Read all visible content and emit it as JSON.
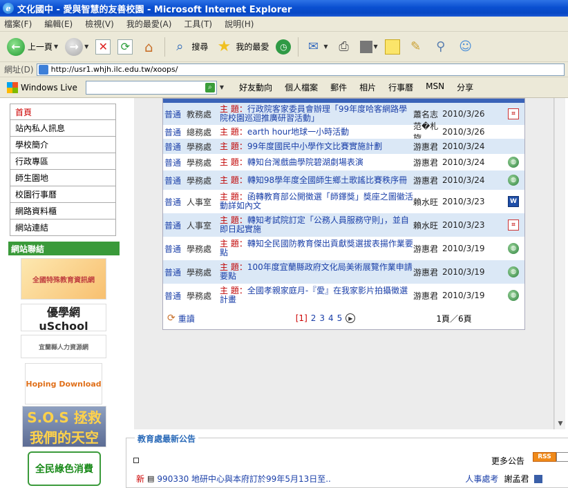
{
  "window": {
    "title": "文化國中 - 愛與智慧的友善校園 - Microsoft Internet Explorer"
  },
  "menu": [
    "檔案(F)",
    "編輯(E)",
    "檢視(V)",
    "我的最愛(A)",
    "工具(T)",
    "說明(H)"
  ],
  "toolbar": {
    "back_label": "上一頁",
    "search_label": "搜尋",
    "favorites_label": "我的最愛"
  },
  "address": {
    "label": "網址(D)",
    "url": "http://usr1.whjh.ilc.edu.tw/xoops/"
  },
  "livebar": {
    "brand": "Windows Live",
    "links": [
      "好友動向",
      "個人檔案",
      "郵件",
      "相片",
      "行事曆",
      "MSN",
      "分享"
    ]
  },
  "sidebar": {
    "items": [
      "首頁",
      "站內私人訊息",
      "學校簡介",
      "行政專區",
      "師生園地",
      "校園行事曆",
      "網路資料櫃",
      "網站連結"
    ],
    "links_header": "網站聯結",
    "banners": [
      "全國特殊教育資訊網",
      "優學網 uSchool",
      "宜蘭縣人力資源網",
      "Hoping Download",
      "S.O.S 拯救我們的天空",
      "全民綠色消費"
    ]
  },
  "news": {
    "subject_prefix": "主 題：",
    "rows": [
      {
        "type": "普通",
        "dept": "教務處",
        "title": "行政院客家委員會辦理「99年度哈客網路學院校園巡迴推廣研習活動」",
        "author": "蕭名志",
        "date": "2010/3/26",
        "icon": "pdf-icon",
        "alt": true
      },
      {
        "type": "普通",
        "dept": "總務處",
        "title": "earth hour地球一小時活動",
        "author": "范�札旋",
        "date": "2010/3/26",
        "icon": "",
        "alt": false
      },
      {
        "type": "普通",
        "dept": "學務處",
        "title": "99年度國民中小學作文比賽實施計劃",
        "author": "游惠君",
        "date": "2010/3/24",
        "icon": "",
        "alt": true
      },
      {
        "type": "普通",
        "dept": "學務處",
        "title": "轉知台灣戲曲學院碧湖劇場表演",
        "author": "游惠君",
        "date": "2010/3/24",
        "icon": "web-icon",
        "alt": false
      },
      {
        "type": "普通",
        "dept": "學務處",
        "title": "轉知98學年度全國師生鄉土歌謠比賽秩序冊",
        "author": "游惠君",
        "date": "2010/3/24",
        "icon": "web-icon",
        "alt": true
      },
      {
        "type": "普通",
        "dept": "人事室",
        "title": "函轉教育部公開徵選「師鐸獎」獎座之圖徽活動詳如內文",
        "author": "賴水旺",
        "date": "2010/3/23",
        "icon": "doc-icon",
        "alt": false
      },
      {
        "type": "普通",
        "dept": "人事室",
        "title": "轉知考試院訂定「公務人員服務守則」，並自即日起實施",
        "author": "賴水旺",
        "date": "2010/3/23",
        "icon": "pdf-icon",
        "alt": true
      },
      {
        "type": "普通",
        "dept": "學務處",
        "title": "轉知全民國防教育傑出貢獻獎選拔表揚作業要點",
        "author": "游惠君",
        "date": "2010/3/19",
        "icon": "web-icon",
        "alt": false
      },
      {
        "type": "普通",
        "dept": "學務處",
        "title": "100年度宜蘭縣政府文化局美術展覽作業申請要點",
        "author": "游惠君",
        "date": "2010/3/19",
        "icon": "web-icon",
        "alt": true
      },
      {
        "type": "普通",
        "dept": "學務處",
        "title": "全國孝親家庭月-『愛』在我家影片拍攝徵選計畫",
        "author": "游惠君",
        "date": "2010/3/19",
        "icon": "web-icon",
        "alt": false
      }
    ],
    "pager": {
      "reload": "重讀",
      "current": "[1]",
      "pages": [
        "2",
        "3",
        "4",
        "5"
      ],
      "count": "1頁／6頁"
    }
  },
  "bottom": {
    "title": "教育處最新公告",
    "more": "更多公告",
    "rss": "RSS",
    "item": {
      "tag": "新",
      "text": "990330 地研中心與本府訂於99年5月13日至..",
      "dept": "人事處考",
      "author": "謝孟君"
    }
  }
}
